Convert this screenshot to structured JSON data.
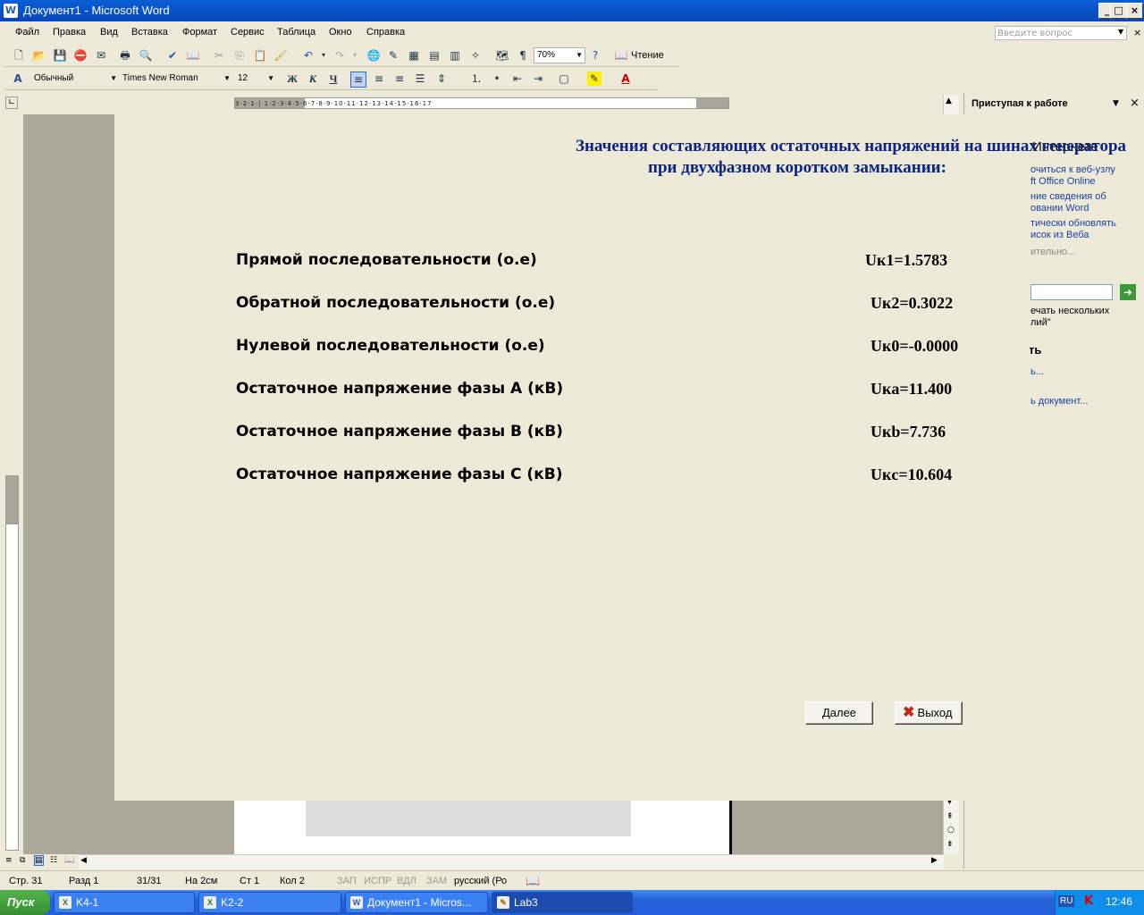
{
  "window": {
    "title": "Документ1 - Microsoft Word",
    "app_icon": "word-app-icon",
    "buttons": [
      "_",
      "□",
      "×"
    ]
  },
  "menu": {
    "items": [
      "Файл",
      "Правка",
      "Вид",
      "Вставка",
      "Формат",
      "Сервис",
      "Таблица",
      "Окно",
      "Справка"
    ],
    "ask_placeholder": "Введите вопрос"
  },
  "toolbar_standard": {
    "zoom": "70%",
    "reading_label": "Чтение"
  },
  "toolbar_formatting": {
    "style": "Обычный",
    "font": "Times New Roman",
    "size": "12",
    "bold": "Ж",
    "italic": "К",
    "underline": "Ч"
  },
  "task_pane": {
    "title": "Приступая к работе",
    "section_online": "Интернете",
    "links": [
      "очиться к веб-узлу",
      "ft Office Online",
      "ние сведения об",
      "овании Word",
      "тически обновлять",
      "исок из Веба",
      "ительно..."
    ],
    "search_hint_1": "ечать нескольких",
    "search_hint_2": "лий\"",
    "section_open": "ть",
    "open_link_1": "ь...",
    "open_link_2": "ь документ..."
  },
  "dialog": {
    "title_line1": "Значения  составляющих остаточных напряжений на шинах генератора",
    "title_line2": "при двухфазном коротком замыкании:",
    "rows": [
      {
        "label": "Прямой последовательности (о.е)",
        "value": "Uк1=1.5783"
      },
      {
        "label": "Обратной последовательности (о.е)",
        "value": "Uк2=0.3022"
      },
      {
        "label": "Нулевой последовательности (о.е)",
        "value": "Uк0=-0.0000"
      },
      {
        "label": "Остаточное напряжение фазы А (кВ)",
        "value": "Uкa=11.400"
      },
      {
        "label": "Остаточное напряжение фазы В (кВ)",
        "value": "Uкb=7.736"
      },
      {
        "label": "Остаточное напряжение фазы С (кВ)",
        "value": "Uкc=10.604"
      }
    ],
    "next_button": "Далее",
    "exit_button": "Выход"
  },
  "statusbar": {
    "page": "Стр.  31",
    "section": "Разд  1",
    "pages": "31/31",
    "at": "На  2см",
    "line": "Ст  1",
    "col": "Кол  2",
    "rec": "ЗАП",
    "trk": "ИСПР",
    "ext": "ВДЛ",
    "ovr": "ЗАМ",
    "lang": "русский (Ро"
  },
  "taskbar": {
    "start": "Пуск",
    "tasks": [
      "K4-1",
      "K2-2",
      "Документ1 - Micros...",
      "Lab3"
    ],
    "lang": "RU",
    "time": "12:46"
  },
  "colors": {
    "dialog_title": "#0c2585",
    "taskbar": "#245edb",
    "start_button": "#388e2f",
    "exit_icon": "#c0281c"
  }
}
